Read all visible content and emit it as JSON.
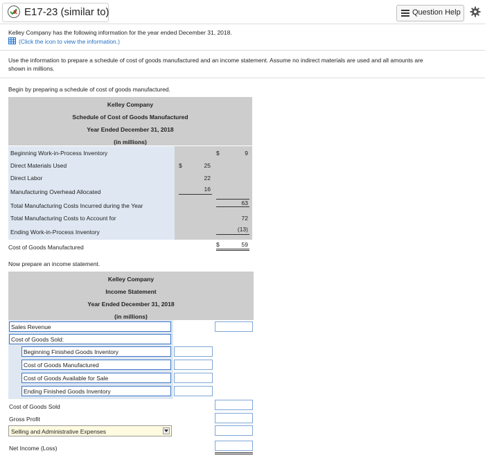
{
  "header": {
    "title": "E17-23 (similar to)",
    "question_help": "Question Help"
  },
  "intro": {
    "line1": "Kelley Company has the following information for the year ended December 31, 2018.",
    "link": "(Click the icon to view the information.)",
    "instructions_1": "Use the information to prepare a schedule of cost of goods manufactured and an income statement. Assume no indirect materials are used and all amounts are",
    "instructions_2": "shown in millions.",
    "begin": "Begin by preparing a schedule of cost of goods manufactured.",
    "now": "Now prepare an income statement."
  },
  "cogm": {
    "company": "Kelley Company",
    "title": "Schedule of Cost of Goods Manufactured",
    "period": "Year Ended December 31, 2018",
    "units": "(in millions)",
    "rows": [
      {
        "label": "Beginning Work-in-Process Inventory",
        "dollar2": "$",
        "col2": "9"
      },
      {
        "label": "Direct Materials Used",
        "dollar1": "$",
        "col1": "25"
      },
      {
        "label": "Direct Labor",
        "col1": "22"
      },
      {
        "label": "Manufacturing Overhead Allocated",
        "col1": "16"
      },
      {
        "label": "Total Manufacturing Costs Incurred during the Year",
        "col2": "63"
      },
      {
        "label": "Total Manufacturing Costs to Account for",
        "col2": "72"
      },
      {
        "label": "Ending Work-in-Process Inventory",
        "col2": "(13)"
      },
      {
        "label": "Cost of Goods Manufactured",
        "dollar2": "$",
        "col2": "59"
      }
    ]
  },
  "income": {
    "company": "Kelley Company",
    "title": "Income Statement",
    "period": "Year Ended December 31, 2018",
    "units": "(in millions)",
    "sales_revenue": "Sales Revenue",
    "cogs_header": "Cost of Goods Sold:",
    "beg_fg": "Beginning Finished Goods Inventory",
    "cogm": "Cost of Goods Manufactured",
    "cogas": "Cost of Goods Available for Sale",
    "end_fg": "Ending Finished Goods Inventory",
    "cogs": "Cost of Goods Sold",
    "gross_profit": "Gross Profit",
    "sga_selected": "Selling and Administrative Expenses",
    "net_income": "Net Income (Loss)"
  }
}
